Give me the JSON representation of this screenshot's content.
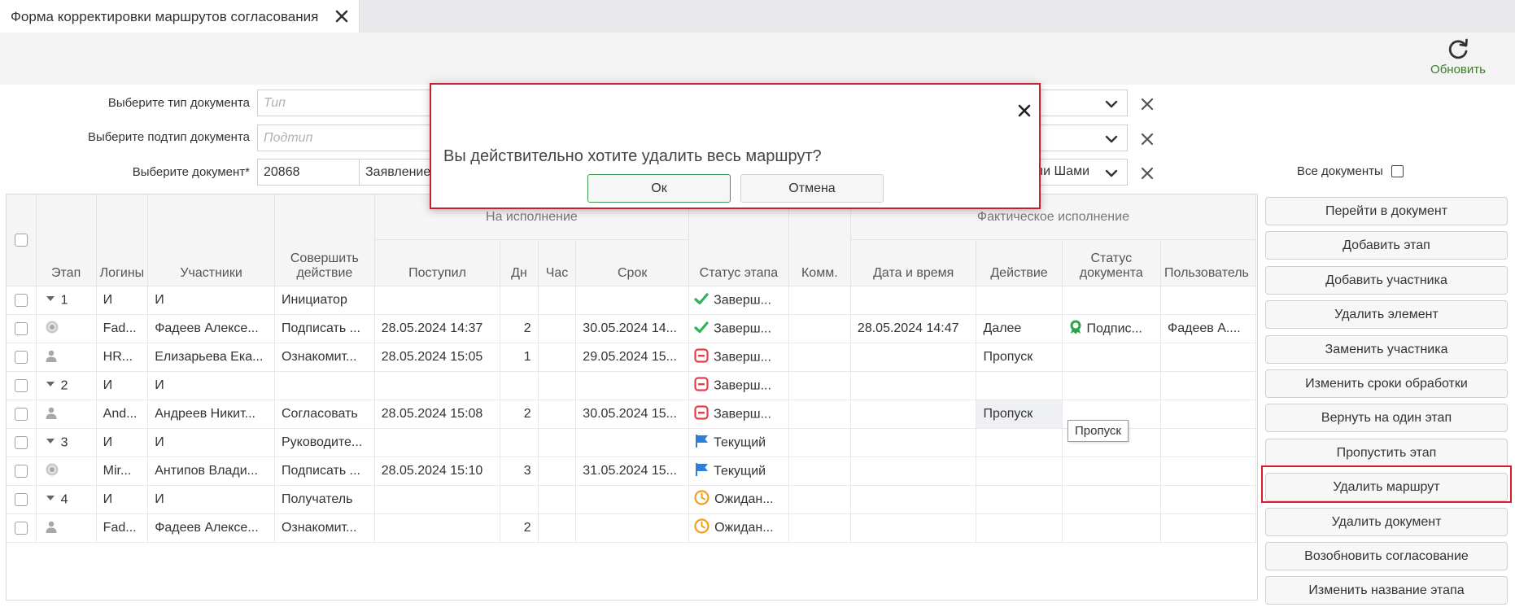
{
  "tab": {
    "title": "Форма корректировки маршрутов согласования"
  },
  "toolbar": {
    "refresh_label": "Обновить"
  },
  "filters": {
    "doc_type_label": "Выберите тип документа",
    "doc_type_placeholder": "Тип",
    "doc_subtype_label": "Выберите подтип документа",
    "doc_subtype_placeholder": "Подтип",
    "document_label": "Выберите документ*",
    "document_number": "20868",
    "document_name": "Заявление",
    "document_combo_value": "ли Шами",
    "all_documents_label": "Все документы"
  },
  "grid": {
    "headers": {
      "stage": "Этап",
      "logins": "Логины",
      "participants": "Участники",
      "action": "Совершить действие",
      "group_execution": "На исполнение",
      "received": "Поступил",
      "days": "Дн",
      "hours": "Час",
      "deadline": "Срок",
      "stage_status": "Статус этапа",
      "comm": "Комм.",
      "group_actual": "Фактическое исполнение",
      "datetime": "Дата и время",
      "act": "Действие",
      "doc_status": "Статус документа",
      "user": "Пользователь"
    },
    "rows": [
      {
        "icon": "expand",
        "stage": "1",
        "login": "И",
        "participant": "И",
        "action": "Инициатор",
        "received": "",
        "days": "",
        "hours": "",
        "deadline": "",
        "status_icon": "check",
        "status": "Заверш...",
        "comm": "",
        "datetime": "",
        "act": "",
        "doc_status_icon": "",
        "doc_status": "",
        "user": ""
      },
      {
        "icon": "gear",
        "stage": "",
        "login": "Fad...",
        "participant": "Фадеев Алексе...",
        "action": "Подписать ...",
        "received": "28.05.2024 14:37",
        "days": "2",
        "hours": "",
        "deadline": "30.05.2024 14...",
        "status_icon": "check",
        "status": "Заверш...",
        "comm": "",
        "datetime": "28.05.2024 14:47",
        "act": "Далее",
        "doc_status_icon": "badge",
        "doc_status": "Подпис...",
        "user": "Фадеев А...."
      },
      {
        "icon": "person",
        "stage": "",
        "login": "HR...",
        "participant": "Елизарьева Ека...",
        "action": "Ознакомит...",
        "received": "28.05.2024 15:05",
        "days": "1",
        "hours": "",
        "deadline": "29.05.2024 15...",
        "status_icon": "minus",
        "status": "Заверш...",
        "comm": "",
        "datetime": "",
        "act": "Пропуск",
        "doc_status_icon": "",
        "doc_status": "",
        "user": ""
      },
      {
        "icon": "expand",
        "stage": "2",
        "login": "И",
        "participant": "И",
        "action": "",
        "received": "",
        "days": "",
        "hours": "",
        "deadline": "",
        "status_icon": "minus",
        "status": "Заверш...",
        "comm": "",
        "datetime": "",
        "act": "",
        "doc_status_icon": "",
        "doc_status": "",
        "user": ""
      },
      {
        "icon": "person",
        "stage": "",
        "login": "And...",
        "participant": "Андреев Никит...",
        "action": "Согласовать",
        "received": "28.05.2024 15:08",
        "days": "2",
        "hours": "",
        "deadline": "30.05.2024 15...",
        "status_icon": "minus",
        "status": "Заверш...",
        "comm": "",
        "datetime": "",
        "act": "Пропуск",
        "doc_status_icon": "",
        "doc_status": "",
        "user": "",
        "act_highlight": true
      },
      {
        "icon": "expand",
        "stage": "3",
        "login": "И",
        "participant": "И",
        "action": "Руководите...",
        "received": "",
        "days": "",
        "hours": "",
        "deadline": "",
        "status_icon": "flag",
        "status": "Текущий",
        "comm": "",
        "datetime": "",
        "act": "",
        "doc_status_icon": "",
        "doc_status": "",
        "user": ""
      },
      {
        "icon": "gear",
        "stage": "",
        "login": "Mir...",
        "participant": "Антипов Влади...",
        "action": "Подписать ...",
        "received": "28.05.2024 15:10",
        "days": "3",
        "hours": "",
        "deadline": "31.05.2024 15...",
        "status_icon": "flag",
        "status": "Текущий",
        "comm": "",
        "datetime": "",
        "act": "",
        "doc_status_icon": "",
        "doc_status": "",
        "user": ""
      },
      {
        "icon": "expand",
        "stage": "4",
        "login": "И",
        "participant": "И",
        "action": "Получатель",
        "received": "",
        "days": "",
        "hours": "",
        "deadline": "",
        "status_icon": "clock",
        "status": "Ожидан...",
        "comm": "",
        "datetime": "",
        "act": "",
        "doc_status_icon": "",
        "doc_status": "",
        "user": ""
      },
      {
        "icon": "person",
        "stage": "",
        "login": "Fad...",
        "participant": "Фадеев Алексе...",
        "action": "Ознакомит...",
        "received": "",
        "days": "2",
        "hours": "",
        "deadline": "",
        "status_icon": "clock",
        "status": "Ожидан...",
        "comm": "",
        "datetime": "",
        "act": "",
        "doc_status_icon": "",
        "doc_status": "",
        "user": ""
      }
    ],
    "tooltip": "Пропуск"
  },
  "actions": [
    "Перейти в документ",
    "Добавить этап",
    "Добавить участника",
    "Удалить элемент",
    "Заменить участника",
    "Изменить сроки обработки",
    "Вернуть на один этап",
    "Пропустить этап",
    "Удалить маршрут",
    "Удалить документ",
    "Возобновить согласование",
    "Изменить название этапа"
  ],
  "modal": {
    "message": "Вы действительно хотите удалить весь маршрут?",
    "ok_label": "Ок",
    "cancel_label": "Отмена"
  },
  "colors": {
    "accent_green": "#3a7d2c",
    "check_green": "#2fb35a",
    "minus_red": "#e0404a",
    "flag_blue": "#2d7fd8",
    "clock_orange": "#f0a020",
    "focus_red": "#d21f2b"
  }
}
